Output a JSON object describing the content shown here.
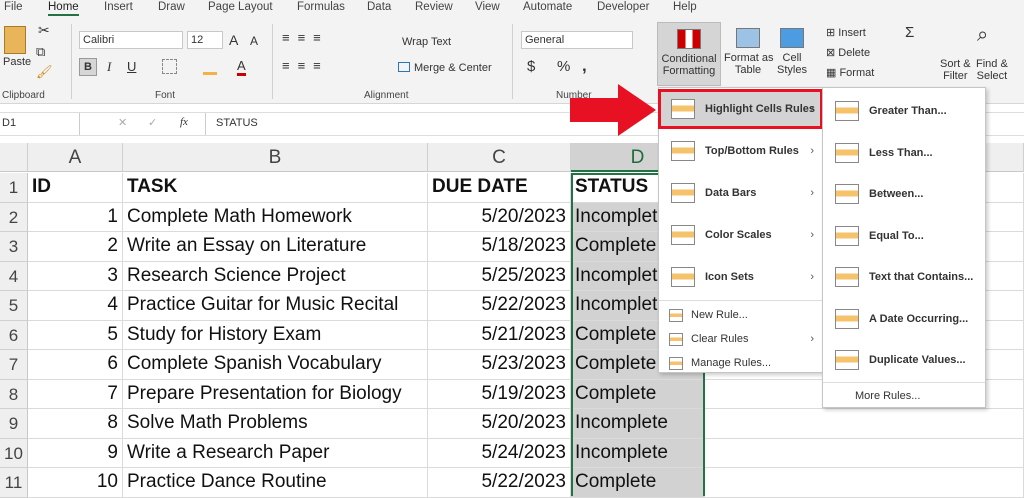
{
  "tabs": [
    "File",
    "Home",
    "Insert",
    "Draw",
    "Page Layout",
    "Formulas",
    "Data",
    "Review",
    "View",
    "Automate",
    "Developer",
    "Help"
  ],
  "ribbon": {
    "paste": "Paste",
    "font_name": "Calibri",
    "font_size": "12",
    "bold": "B",
    "italic": "I",
    "underline": "U",
    "wrap_text": "Wrap Text",
    "merge_center": "Merge & Center",
    "number_format": "General",
    "currency": "$",
    "percent": "%",
    "comma": ",",
    "cond_fmt_1": "Conditional",
    "cond_fmt_2": "Formatting",
    "fmt_table_1": "Format as",
    "fmt_table_2": "Table",
    "cell_styles_1": "Cell",
    "cell_styles_2": "Styles",
    "insert": "Insert",
    "delete": "Delete",
    "format": "Format",
    "sort_1": "Sort &",
    "sort_2": "Filter",
    "find_1": "Find &",
    "find_2": "Select",
    "groups": {
      "clipboard": "Clipboard",
      "font": "Font",
      "alignment": "Alignment",
      "number": "Number"
    }
  },
  "formula_bar": {
    "name_box": "D1",
    "fx": "fx",
    "value": "STATUS"
  },
  "columns": [
    "A",
    "B",
    "C",
    "D"
  ],
  "rows": [
    {
      "n": "1",
      "id": "ID",
      "task": "TASK",
      "due": "DUE DATE",
      "status": "STATUS"
    },
    {
      "n": "2",
      "id": "1",
      "task": "Complete Math Homework",
      "due": "5/20/2023",
      "status": "Incomplete"
    },
    {
      "n": "3",
      "id": "2",
      "task": "Write an Essay on Literature",
      "due": "5/18/2023",
      "status": "Complete"
    },
    {
      "n": "4",
      "id": "3",
      "task": "Research Science Project",
      "due": "5/25/2023",
      "status": "Incomplete"
    },
    {
      "n": "5",
      "id": "4",
      "task": "Practice Guitar for Music Recital",
      "due": "5/22/2023",
      "status": "Incomplete"
    },
    {
      "n": "6",
      "id": "5",
      "task": "Study for History Exam",
      "due": "5/21/2023",
      "status": "Complete"
    },
    {
      "n": "7",
      "id": "6",
      "task": "Complete Spanish Vocabulary",
      "due": "5/23/2023",
      "status": "Complete"
    },
    {
      "n": "8",
      "id": "7",
      "task": "Prepare Presentation for Biology",
      "due": "5/19/2023",
      "status": "Complete"
    },
    {
      "n": "9",
      "id": "8",
      "task": "Solve Math Problems",
      "due": "5/20/2023",
      "status": "Incomplete"
    },
    {
      "n": "10",
      "id": "9",
      "task": "Write a Research Paper",
      "due": "5/24/2023",
      "status": "Incomplete"
    },
    {
      "n": "11",
      "id": "10",
      "task": "Practice Dance Routine",
      "due": "5/22/2023",
      "status": "Complete"
    }
  ],
  "menu": {
    "items": [
      "Highlight Cells Rules",
      "Top/Bottom Rules",
      "Data Bars",
      "Color Scales",
      "Icon Sets"
    ],
    "small": [
      "New Rule...",
      "Clear Rules",
      "Manage Rules..."
    ]
  },
  "submenu": {
    "items": [
      "Greater Than...",
      "Less Than...",
      "Between...",
      "Equal To...",
      "Text that Contains...",
      "A Date Occurring...",
      "Duplicate Values..."
    ],
    "more": "More Rules..."
  },
  "colors": {
    "accent": "#217346",
    "highlight": "#e81123"
  }
}
